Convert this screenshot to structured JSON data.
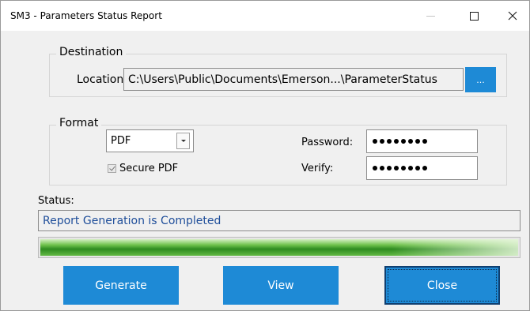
{
  "window": {
    "title": "SM3 - Parameters Status Report"
  },
  "titlebar_icons": [
    "minimize-icon",
    "maximize-icon",
    "close-icon"
  ],
  "destination": {
    "legend": "Destination",
    "location_label": "Location:",
    "location_value": "C:\\Users\\Public\\Documents\\Emerson...\\ParameterStatus",
    "browse_label": "..."
  },
  "format": {
    "legend": "Format",
    "type_selected": "PDF",
    "secure_pdf_label": "Secure PDF",
    "secure_pdf_checked": true,
    "password_label": "Password:",
    "password_mask_length": 8,
    "verify_label": "Verify:",
    "verify_mask_length": 8
  },
  "status": {
    "label": "Status:",
    "message": "Report Generation is Completed"
  },
  "progress": {
    "fraction": 1.0
  },
  "buttons": {
    "generate": "Generate",
    "view": "View",
    "close": "Close"
  },
  "colors": {
    "accent": "#1e8ad6",
    "status_text": "#1f4e9a",
    "progress_green": "#2e8b20"
  }
}
